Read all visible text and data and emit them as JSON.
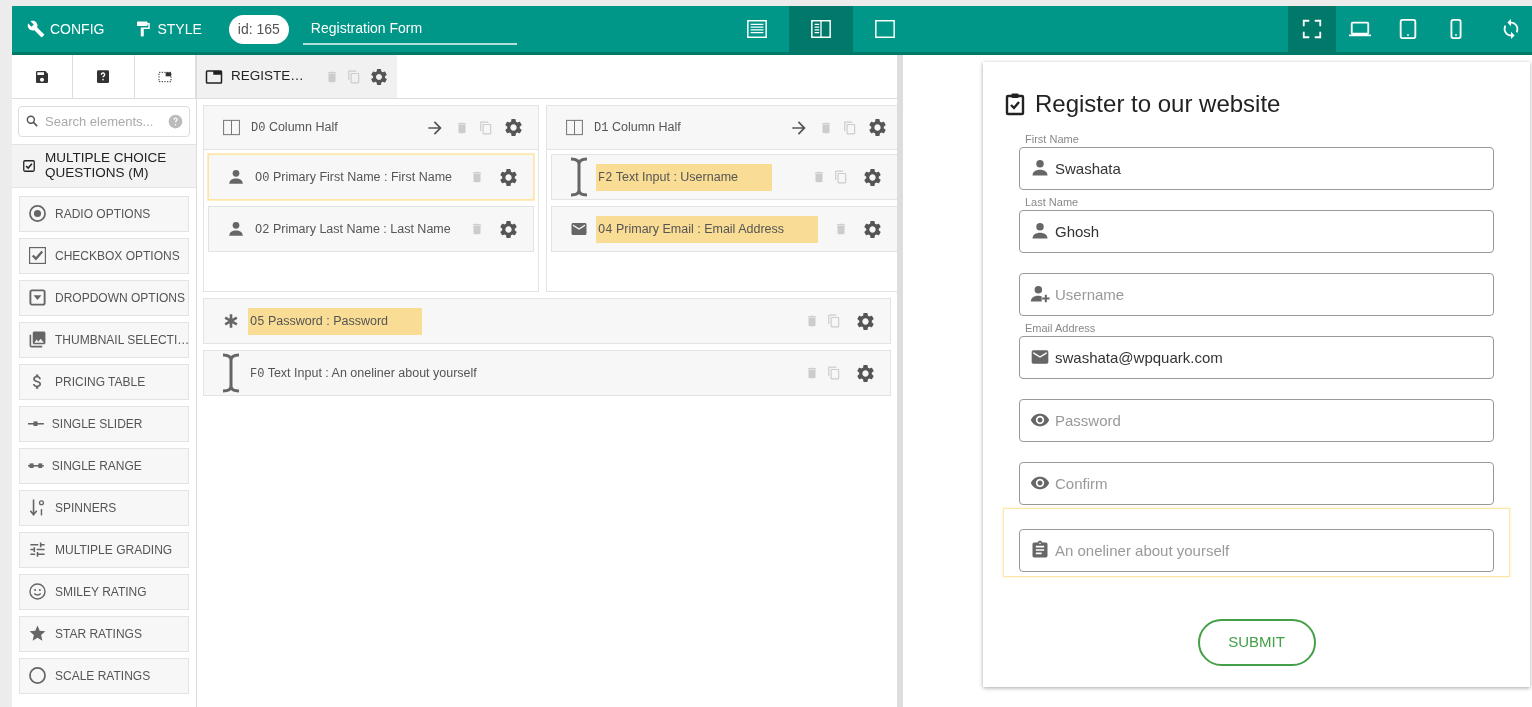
{
  "topbar": {
    "tabs": [
      {
        "label": "CONFIG",
        "kind": "wrench"
      },
      {
        "label": "STYLE",
        "kind": "roller"
      }
    ],
    "form_id": "id: 165",
    "form_name": "Registration Form",
    "layouts": [
      {
        "kind": "rows",
        "selected": false
      },
      {
        "kind": "split",
        "selected": true
      },
      {
        "kind": "square",
        "selected": false
      }
    ],
    "devices": [
      {
        "kind": "fullscreen",
        "selected": true
      },
      {
        "kind": "laptop",
        "selected": false
      },
      {
        "kind": "tablet",
        "selected": false
      },
      {
        "kind": "phone",
        "selected": false
      }
    ]
  },
  "sidebar": {
    "tools": [
      {
        "kind": "save"
      },
      {
        "kind": "help"
      },
      {
        "kind": "select"
      }
    ],
    "search_placeholder": "Search elements...",
    "category": "MULTIPLE CHOICE QUESTIONS (M)",
    "elements": [
      {
        "label": "RADIO OPTIONS",
        "kind": "radio"
      },
      {
        "label": "CHECKBOX OPTIONS",
        "kind": "checkbox"
      },
      {
        "label": "DROPDOWN OPTIONS",
        "kind": "dropdown"
      },
      {
        "label": "THUMBNAIL SELECTI…",
        "kind": "images"
      },
      {
        "label": "PRICING TABLE",
        "kind": "dollar"
      },
      {
        "label": "SINGLE SLIDER",
        "kind": "slider"
      },
      {
        "label": "SINGLE RANGE",
        "kind": "range"
      },
      {
        "label": "SPINNERS",
        "kind": "spinners"
      },
      {
        "label": "MULTIPLE GRADING",
        "kind": "grading"
      },
      {
        "label": "SMILEY RATING",
        "kind": "smiley"
      },
      {
        "label": "STAR RATINGS",
        "kind": "star"
      },
      {
        "label": "SCALE RATINGS",
        "kind": "circle"
      }
    ]
  },
  "builder": {
    "tab": "REGISTE…",
    "columns": [
      {
        "code": "D0",
        "title": "Column Half",
        "items": [
          {
            "code": "O0",
            "label": "Primary First Name : First Name",
            "kind": "user",
            "selected": true,
            "highlighted": false,
            "duplicable": false
          },
          {
            "code": "O2",
            "label": "Primary Last Name : Last Name",
            "kind": "user",
            "selected": false,
            "highlighted": false,
            "duplicable": false
          }
        ]
      },
      {
        "code": "D1",
        "title": "Column Half",
        "items": [
          {
            "code": "F2",
            "label": "Text Input : Username",
            "kind": "cursor",
            "selected": false,
            "highlighted": true,
            "duplicable": true
          },
          {
            "code": "O4",
            "label": "Primary Email : Email Address",
            "kind": "envelope",
            "selected": false,
            "highlighted": true,
            "duplicable": false
          }
        ]
      }
    ],
    "rows": [
      {
        "code": "O5",
        "label": "Password : Password",
        "kind": "asterisk",
        "selected": false,
        "highlighted": true,
        "duplicable": true
      },
      {
        "code": "F0",
        "label": "Text Input : An oneliner about yourself",
        "kind": "cursor",
        "selected": false,
        "highlighted": false,
        "duplicable": true
      }
    ]
  },
  "preview": {
    "title": "Register to our website",
    "fields": [
      {
        "label": "First Name",
        "kind": "user",
        "value": "Swashata",
        "selected": false
      },
      {
        "label": "Last Name",
        "kind": "user",
        "value": "Ghosh",
        "selected": false
      },
      {
        "kind": "user-plus",
        "placeholder": "Username",
        "selected": false
      },
      {
        "label": "Email Address",
        "kind": "envelope",
        "value": "swashata@wpquark.com",
        "selected": false
      },
      {
        "kind": "eye",
        "placeholder": "Password",
        "selected": false
      },
      {
        "kind": "eye",
        "placeholder": "Confirm",
        "selected": false
      },
      {
        "kind": "clipboard",
        "placeholder": "An oneliner about yourself",
        "selected": true
      }
    ],
    "submit": "SUBMIT"
  }
}
